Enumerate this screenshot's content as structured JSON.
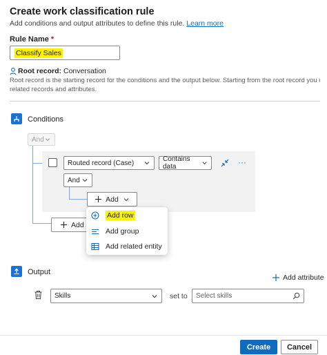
{
  "header": {
    "title": "Create work classification rule",
    "subtitle": "Add conditions and output attributes to define this rule.",
    "learn_more": "Learn more"
  },
  "rule_name": {
    "label": "Rule Name",
    "required_mark": "*",
    "value": "Classify Sales"
  },
  "root_record": {
    "label": "Root record:",
    "value": "Conversation",
    "help_line1": "Root record is the starting record for the conditions and the output below. Starting from the root record you can navigate to its",
    "help_line2": "related records and attributes."
  },
  "conditions": {
    "title": "Conditions",
    "outer_operator": "And",
    "row": {
      "field": "Routed record (Case)",
      "operator": "Contains data",
      "more": "···"
    },
    "inner_operator": "And",
    "inner_add_label": "Add",
    "outer_add_label": "Add"
  },
  "add_menu": {
    "items": [
      {
        "label": "Add row",
        "icon": "circle-plus-icon"
      },
      {
        "label": "Add group",
        "icon": "lines-icon"
      },
      {
        "label": "Add related entity",
        "icon": "table-icon"
      }
    ]
  },
  "output": {
    "title": "Output",
    "add_attribute": "Add attribute",
    "attribute": "Skills",
    "set_to": "set to",
    "placeholder": "Select skills"
  },
  "footer": {
    "create": "Create",
    "cancel": "Cancel"
  },
  "colors": {
    "accent": "#0f6cbd",
    "highlight": "#fff200",
    "connector": "#7ea6e0"
  }
}
